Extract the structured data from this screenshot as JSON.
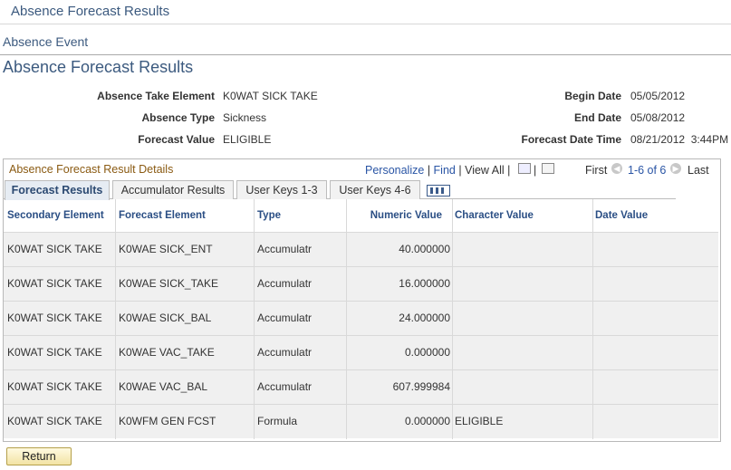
{
  "window": {
    "title": "Absence Forecast Results"
  },
  "breadcrumb": {
    "event_link": "Absence Event"
  },
  "section": {
    "title": "Absence Forecast Results"
  },
  "summary": {
    "take_element_label": "Absence Take Element",
    "take_element_value": "K0WAT SICK TAKE",
    "type_label": "Absence Type",
    "type_value": "Sickness",
    "forecast_label": "Forecast Value",
    "forecast_value": "ELIGIBLE",
    "begin_label": "Begin Date",
    "begin_value": "05/05/2012",
    "end_label": "End Date",
    "end_value": "05/08/2012",
    "fdt_label": "Forecast Date Time",
    "fdt_value": "08/21/2012  3:44PM"
  },
  "grid": {
    "title": "Absence Forecast Result Details",
    "personalize": "Personalize",
    "find": "Find",
    "view_all": "View All",
    "first": "First",
    "range": "1-6 of 6",
    "last": "Last",
    "tabs": [
      "Forecast Results",
      "Accumulator Results",
      "User Keys 1-3",
      "User Keys 4-6"
    ],
    "columns": [
      "Secondary Element",
      "Forecast Element",
      "Type",
      "Numeric Value",
      "Character Value",
      "Date Value"
    ],
    "rows": [
      [
        "K0WAT SICK TAKE",
        "K0WAE SICK_ENT",
        "Accumulatr",
        "40.000000",
        "",
        ""
      ],
      [
        "K0WAT SICK TAKE",
        "K0WAE SICK_TAKE",
        "Accumulatr",
        "16.000000",
        "",
        ""
      ],
      [
        "K0WAT SICK TAKE",
        "K0WAE SICK_BAL",
        "Accumulatr",
        "24.000000",
        "",
        ""
      ],
      [
        "K0WAT SICK TAKE",
        "K0WAE VAC_TAKE",
        "Accumulatr",
        "0.000000",
        "",
        ""
      ],
      [
        "K0WAT SICK TAKE",
        "K0WAE VAC_BAL",
        "Accumulatr",
        "607.999984",
        "",
        ""
      ],
      [
        "K0WAT SICK TAKE",
        "K0WFM GEN FCST",
        "Formula",
        "0.000000",
        "ELIGIBLE",
        ""
      ]
    ]
  },
  "actions": {
    "return_label": "Return"
  }
}
